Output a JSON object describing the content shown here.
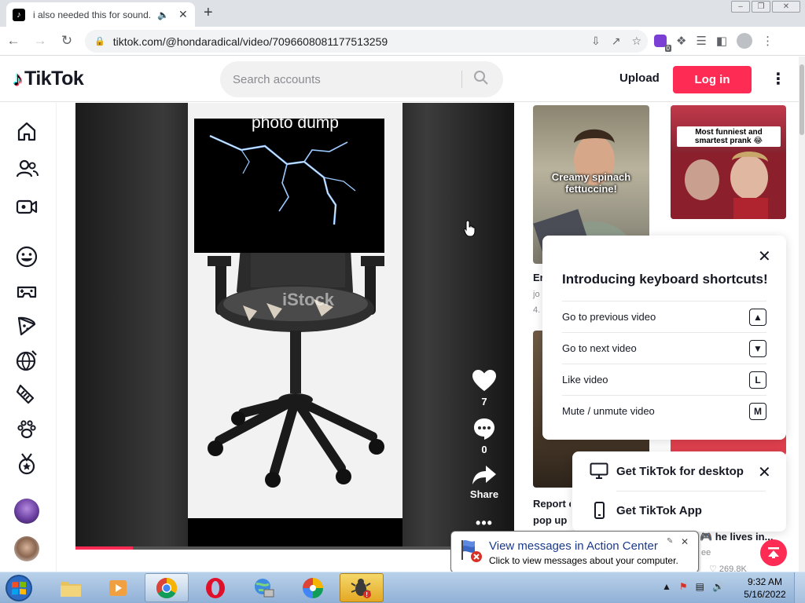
{
  "browser": {
    "tab_title": "i also needed this for sound...",
    "url": "tiktok.com/@hondaradical/video/7096608081177513259",
    "extension_badge": "0"
  },
  "tiktok": {
    "logo_text": "TikTok",
    "search_placeholder": "Search accounts",
    "upload_label": "Upload",
    "login_label": "Log in"
  },
  "video": {
    "caption": "photo dump",
    "like_count": "7",
    "comment_count": "0",
    "share_label": "Share",
    "progress_fraction": 0.13
  },
  "recommendations": {
    "card1_overlay": "Creamy spinach fettuccine!",
    "card1_title": "Er",
    "card1_sub1": "jo",
    "card1_sub2": "4.",
    "card2_overlay": "Most funniest and smartest prank 😂",
    "card3_title_line1": "Report c",
    "card3_title_line2": "pop up",
    "card4_title": "! 🎮 he lives in...",
    "card4_author": "ee",
    "card4_likes": "269.8K"
  },
  "keyboard_popup": {
    "title": "Introducing keyboard shortcuts!",
    "rows": [
      {
        "label": "Go to previous video",
        "key": "▲"
      },
      {
        "label": "Go to next video",
        "key": "▼"
      },
      {
        "label": "Like video",
        "key": "L"
      },
      {
        "label": "Mute / unmute video",
        "key": "M"
      }
    ]
  },
  "app_popup": {
    "desktop_label": "Get TikTok for desktop",
    "app_label": "Get TikTok App"
  },
  "balloon": {
    "title": "View messages in Action Center",
    "message": "Click to view messages about your computer."
  },
  "taskbar": {
    "time": "9:32 AM",
    "date": "5/16/2022"
  },
  "colors": {
    "brand": "#fe2c55",
    "cyan": "#25f4ee"
  }
}
